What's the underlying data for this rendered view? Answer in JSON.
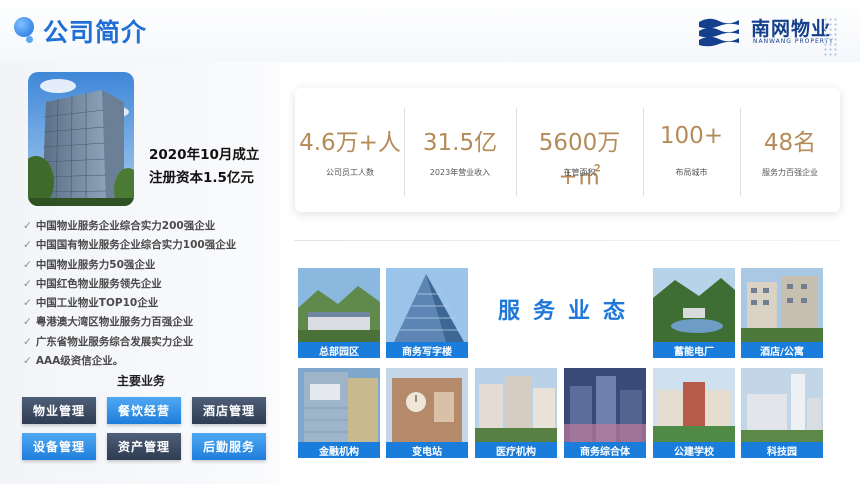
{
  "header": {
    "title": "公司简介",
    "logo_cn": "南网物业",
    "logo_en": "NANWANG PROPERTY"
  },
  "company": {
    "established": "2020年10月成立",
    "capital": "注册资本1.5亿元",
    "honors": [
      "中国物业服务企业综合实力200强企业",
      "中国国有物业服务企业综合实力100强企业",
      "中国物业服务力50强企业",
      "中国红色物业服务领先企业",
      "中国工业物业TOP10企业",
      "粤港澳大湾区物业服务力百强企业",
      "广东省物业服务综合发展实力企业",
      "AAA级资信企业。"
    ]
  },
  "main_business": {
    "title": "主要业务",
    "items": [
      "物业管理",
      "餐饮经营",
      "酒店管理",
      "设备管理",
      "资产管理",
      "后勤服务"
    ]
  },
  "stats": [
    {
      "value": "4.6万+人",
      "label": "公司员工人数"
    },
    {
      "value": "31.5亿",
      "label": "2023年营业收入"
    },
    {
      "value": "5600万+㎡",
      "label": "在管面积"
    },
    {
      "value": "100+",
      "label": "布局城市"
    },
    {
      "value": "48名",
      "label": "服务力百强企业"
    }
  ],
  "service_title": "服务业态",
  "tiles": [
    "总部园区",
    "商务写字楼",
    "蓄能电厂",
    "酒店/公寓",
    "金融机构",
    "变电站",
    "医疗机构",
    "商务综合体",
    "公建学校",
    "科技园"
  ],
  "colors": {
    "brand_blue": "#1f6fd6",
    "stat_gold": "#b58b57",
    "caption_blue": "#1a7ddc",
    "dark_button": "#3a475d"
  }
}
